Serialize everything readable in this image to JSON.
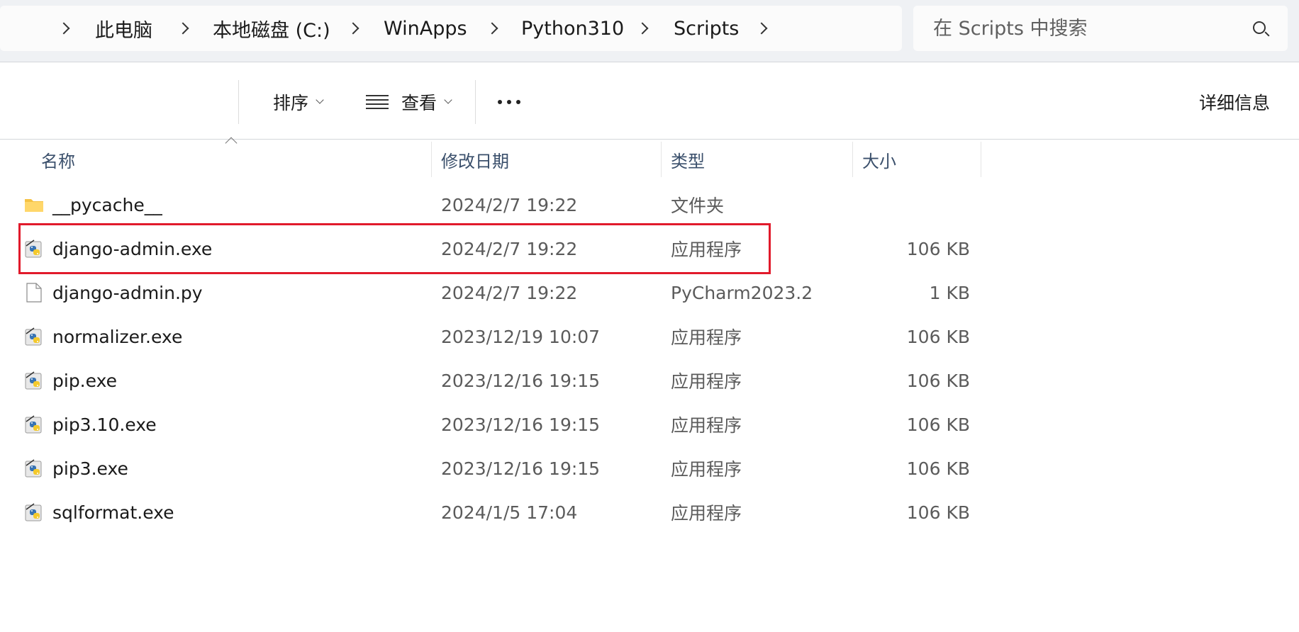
{
  "breadcrumb": {
    "items": [
      "此电脑",
      "本地磁盘 (C:)",
      "WinApps",
      "Python310",
      "Scripts"
    ]
  },
  "search": {
    "placeholder": "在 Scripts 中搜索"
  },
  "toolbar": {
    "sort_label": "排序",
    "view_label": "查看",
    "details_label": "详细信息"
  },
  "columns": {
    "name": "名称",
    "modified": "修改日期",
    "type": "类型",
    "size": "大小"
  },
  "files": [
    {
      "name": "__pycache__",
      "modified": "2024/2/7 19:22",
      "type": "文件夹",
      "size": "",
      "icon": "folder-icon"
    },
    {
      "name": "django-admin.exe",
      "modified": "2024/2/7 19:22",
      "type": "应用程序",
      "size": "106 KB",
      "icon": "python-exe-icon",
      "highlighted": true
    },
    {
      "name": "django-admin.py",
      "modified": "2024/2/7 19:22",
      "type": "PyCharm2023.2",
      "size": "1 KB",
      "icon": "file-icon"
    },
    {
      "name": "normalizer.exe",
      "modified": "2023/12/19 10:07",
      "type": "应用程序",
      "size": "106 KB",
      "icon": "python-exe-icon"
    },
    {
      "name": "pip.exe",
      "modified": "2023/12/16 19:15",
      "type": "应用程序",
      "size": "106 KB",
      "icon": "python-exe-icon"
    },
    {
      "name": "pip3.10.exe",
      "modified": "2023/12/16 19:15",
      "type": "应用程序",
      "size": "106 KB",
      "icon": "python-exe-icon"
    },
    {
      "name": "pip3.exe",
      "modified": "2023/12/16 19:15",
      "type": "应用程序",
      "size": "106 KB",
      "icon": "python-exe-icon"
    },
    {
      "name": "sqlformat.exe",
      "modified": "2024/1/5 17:04",
      "type": "应用程序",
      "size": "106 KB",
      "icon": "python-exe-icon"
    }
  ],
  "colors": {
    "highlight": "#e11a2b",
    "header_text": "#3a4f6b",
    "secondary_text": "#5b5b5b"
  }
}
